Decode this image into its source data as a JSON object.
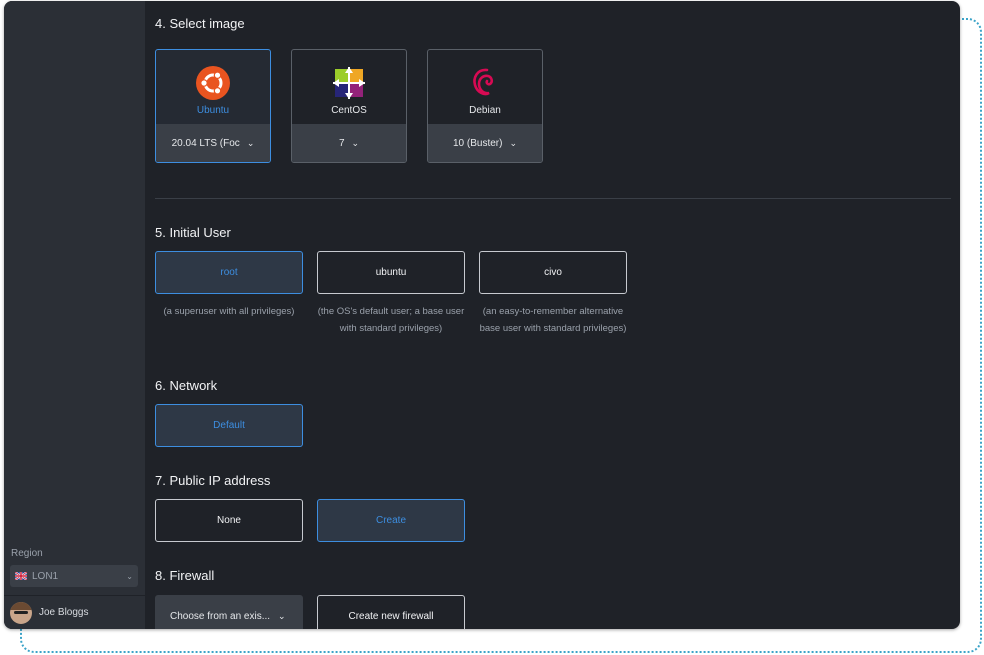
{
  "sidebar": {
    "region_label": "Region",
    "region_value": "LON1",
    "user_name": "Joe Bloggs"
  },
  "sections": {
    "image": {
      "title": "4. Select image",
      "options": [
        {
          "name": "Ubuntu",
          "version": "20.04 LTS (Foc",
          "icon": "ubuntu-icon",
          "selected": true
        },
        {
          "name": "CentOS",
          "version": "7",
          "icon": "centos-icon",
          "selected": false
        },
        {
          "name": "Debian",
          "version": "10 (Buster)",
          "icon": "debian-icon",
          "selected": false
        }
      ]
    },
    "initial_user": {
      "title": "5. Initial User",
      "options": [
        {
          "label": "root",
          "desc": "(a superuser with all privileges)",
          "selected": true
        },
        {
          "label": "ubuntu",
          "desc": "(the OS's default user; a base user with standard privileges)",
          "selected": false
        },
        {
          "label": "civo",
          "desc": "(an easy-to-remember alternative base user with standard privileges)",
          "selected": false
        }
      ]
    },
    "network": {
      "title": "6. Network",
      "options": [
        {
          "label": "Default",
          "selected": true
        }
      ]
    },
    "public_ip": {
      "title": "7. Public IP address",
      "options": [
        {
          "label": "None",
          "selected": false
        },
        {
          "label": "Create",
          "selected": true
        }
      ]
    },
    "firewall": {
      "title": "8. Firewall",
      "dropdown_label": "Choose from an exis...",
      "create_label": "Create new firewall"
    }
  },
  "colors": {
    "accent": "#3d8ee0",
    "window_bg": "#1f2228",
    "sidebar_bg": "#2b2f36",
    "frame_dots": "#3aa3c8"
  }
}
